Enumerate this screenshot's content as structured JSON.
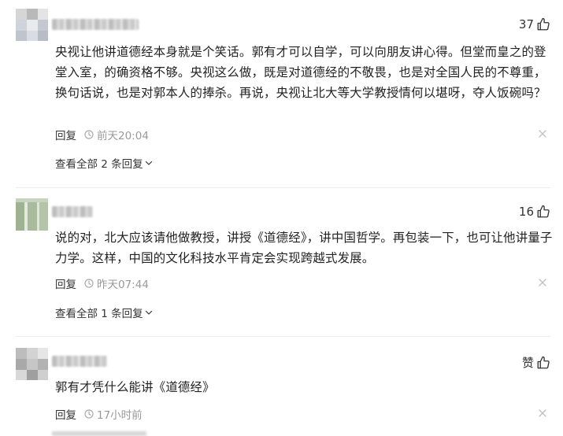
{
  "comments": [
    {
      "likes": "37",
      "content": "央视让他讲道德经本身就是个笑话。郭有才可以自学，可以向朋友讲心得。但堂而皇之的登堂入室，的确资格不够。央视这么做，既是对道德经的不敬畏，也是对全国人民的不尊重，换句话说，也是对郭本人的捧杀。再说，央视让北大等大学教授情何以堪呀，夺人饭碗吗？",
      "reply_label": "回复",
      "time": "前天20:04",
      "more_replies": "查看全部 2 条回复"
    },
    {
      "likes": "16",
      "content": "说的对，北大应该请他做教授，讲授《道德经》，讲中国哲学。再包装一下，也可让他讲量子力学。这样，中国的文化科技水平肯定会实现跨越式发展。",
      "reply_label": "回复",
      "time": "昨天07:44",
      "more_replies": "查看全部 1 条回复"
    },
    {
      "likes": "赞",
      "content": "郭有才凭什么能讲《道德经》",
      "reply_label": "回复",
      "time": "17小时前"
    }
  ],
  "icons": {
    "like": "thumbs-up-icon",
    "clock": "clock-icon",
    "close": "close-icon",
    "expand": "chevron-down-icon"
  },
  "colors": {
    "text": "#222222",
    "meta": "#999999",
    "icon": "#bbbbbb"
  }
}
